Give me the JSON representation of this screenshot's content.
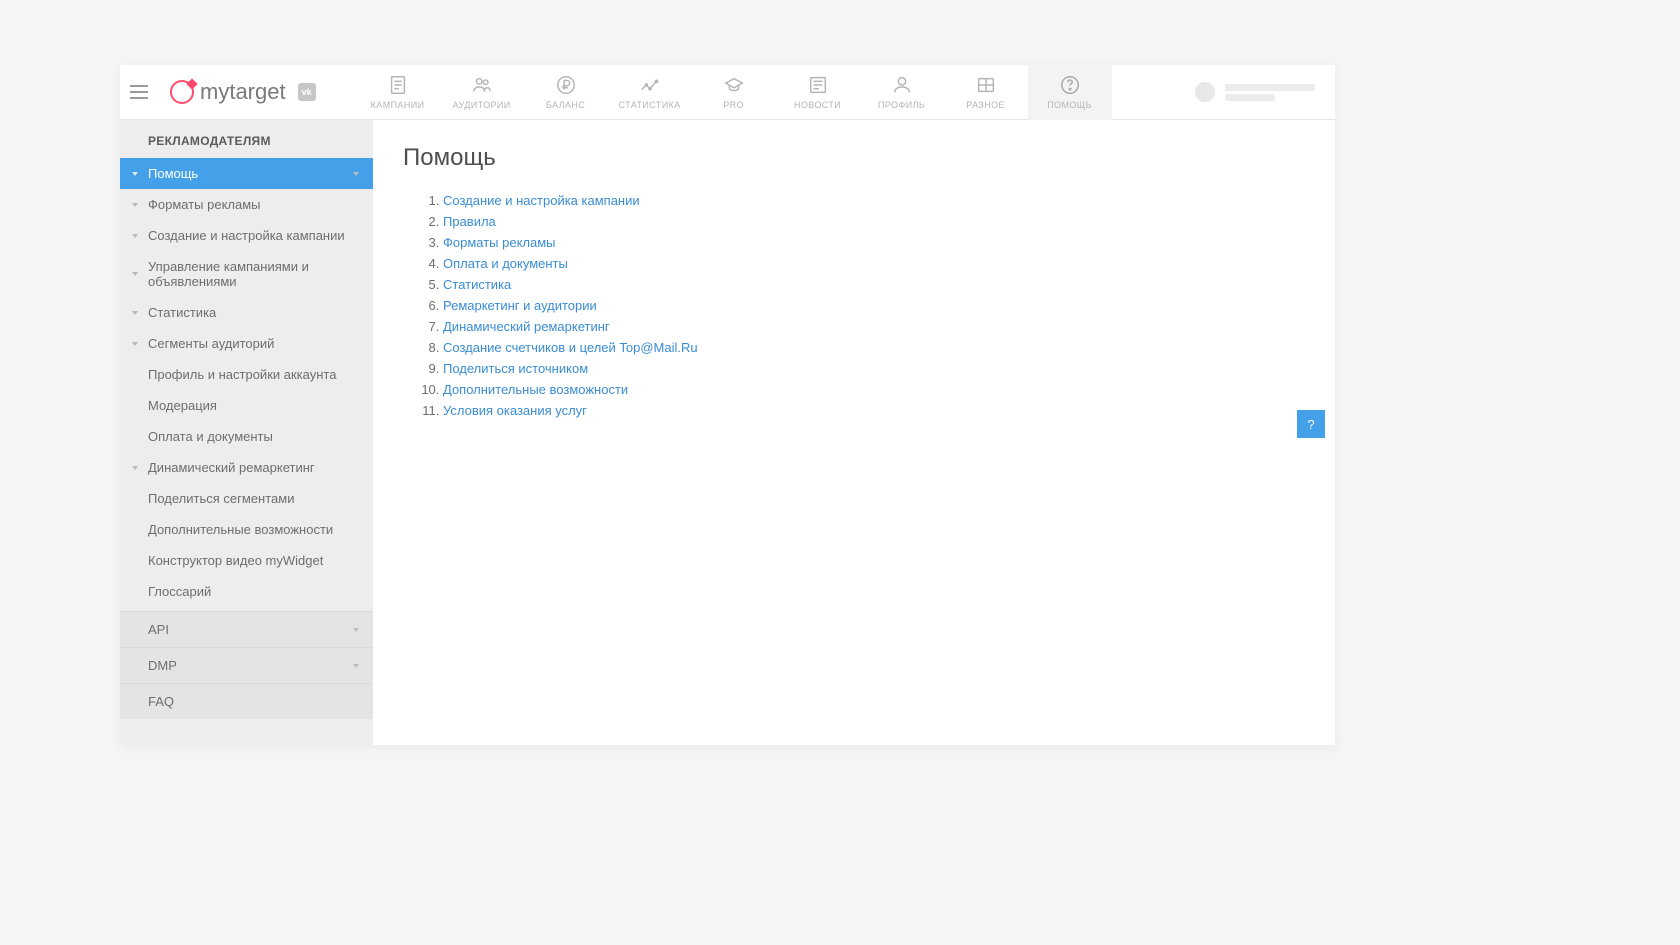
{
  "logo_text": "mytarget",
  "vk_badge": "vk",
  "nav": [
    {
      "label": "КАМПАНИИ"
    },
    {
      "label": "АУДИТОРИИ"
    },
    {
      "label": "БАЛАНС"
    },
    {
      "label": "СТАТИСТИКА"
    },
    {
      "label": "PRO"
    },
    {
      "label": "НОВОСТИ"
    },
    {
      "label": "ПРОФИЛЬ"
    },
    {
      "label": "РАЗНОЕ"
    },
    {
      "label": "ПОМОЩЬ"
    }
  ],
  "sidebar": {
    "heading": "РЕКЛАМОДАТЕЛЯМ",
    "active": "Помощь",
    "items": [
      "Форматы рекламы",
      "Создание и настройка кампании",
      "Управление кампаниями и объявлениями",
      "Статистика",
      "Сегменты аудиторий",
      "Профиль и настройки аккаунта",
      "Модерация",
      "Оплата и документы",
      "Динамический ремаркетинг",
      "Поделиться сегментами",
      "Дополнительные возможности",
      "Конструктор видео myWidget",
      "Глоссарий"
    ],
    "sections": [
      "API",
      "DMP"
    ],
    "faq": "FAQ"
  },
  "page": {
    "title": "Помощь",
    "links": [
      "Создание и настройка кампании",
      "Правила",
      "Форматы рекламы",
      "Оплата и документы",
      "Статистика",
      "Ремаркетинг и аудитории",
      "Динамический ремаркетинг",
      "Создание счетчиков и целей Top@Mail.Ru",
      "Поделиться источником",
      "Дополнительные возможности",
      "Условия оказания услуг"
    ]
  },
  "float_help": "?"
}
